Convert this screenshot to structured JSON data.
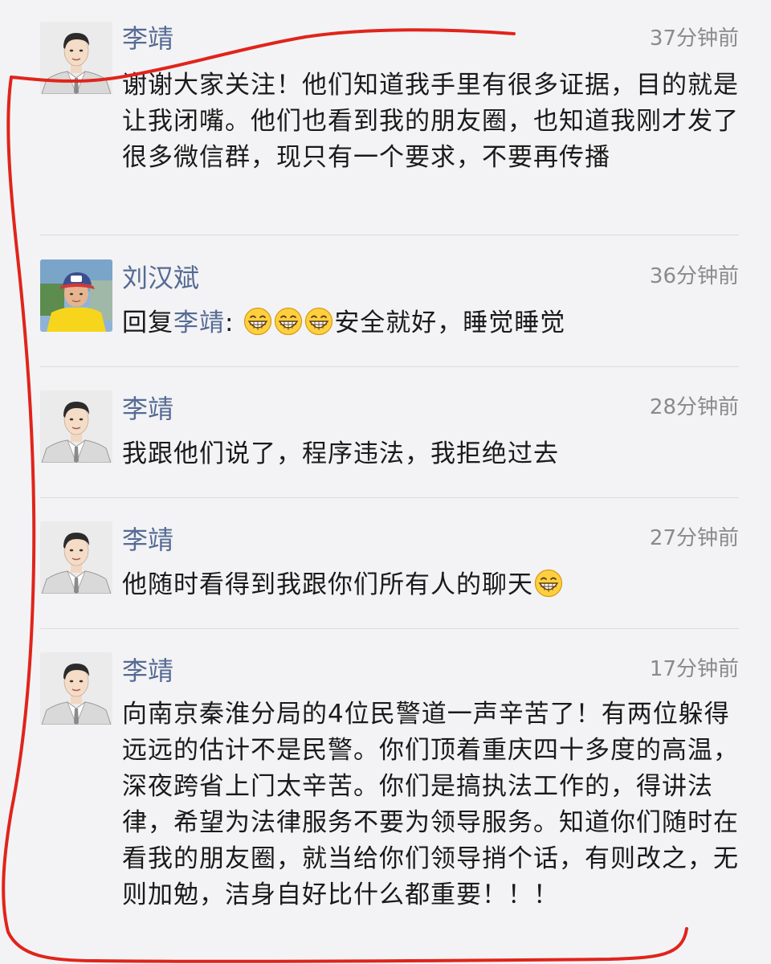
{
  "comments": [
    {
      "name": "李靖",
      "time": "37分钟前",
      "text": "谢谢大家关注！他们知道我手里有很多证据，目的就是让我闭嘴。他们也看到我的朋友圈，也知道我刚才发了很多微信群，现只有一个要求，不要再传播",
      "avatar": "man-in-suit-avatar"
    },
    {
      "name": "刘汉斌",
      "time": "36分钟前",
      "reply_prefix": "回复",
      "reply_to": "李靖",
      "reply_colon": ":",
      "emoji": "grinning-face-icon",
      "text": "安全就好，睡觉睡觉",
      "avatar": "boy-in-cap-avatar"
    },
    {
      "name": "李靖",
      "time": "28分钟前",
      "text": "我跟他们说了，程序违法，我拒绝过去",
      "avatar": "man-in-suit-avatar"
    },
    {
      "name": "李靖",
      "time": "27分钟前",
      "text": "他随时看得到我跟你们所有人的聊天",
      "emoji": "grinning-face-icon",
      "avatar": "man-in-suit-avatar"
    },
    {
      "name": "李靖",
      "time": "17分钟前",
      "text": "向南京秦淮分局的4位民警道一声辛苦了！有两位躲得远远的估计不是民警。你们顶着重庆四十多度的高温，深夜跨省上门太辛苦。你们是搞执法工作的，得讲法律，希望为法律服务不要为领导服务。知道你们随时在看我的朋友圈，就当给你们领导捎个话，有则改之，无则加勉，洁身自好比什么都重要！！！",
      "avatar": "man-in-suit-avatar"
    }
  ],
  "colors": {
    "name": "#566b94",
    "annotation": "#e0241b",
    "background": "#f3f3f5"
  }
}
